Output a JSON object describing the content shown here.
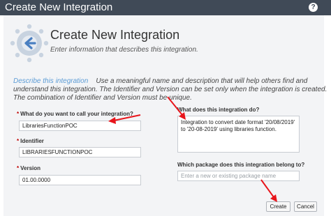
{
  "window": {
    "title": "Create New Integration",
    "help_label": "?"
  },
  "header": {
    "title": "Create New Integration",
    "subtitle": "Enter information that describes this integration."
  },
  "description": {
    "lead": "Describe this integration",
    "text": "Use a meaningful name and description that will help others find and understand this integration. The Identifier and Version can be set only when the integration is created. The combination of Identifier and Version must be unique."
  },
  "form": {
    "name": {
      "label": "What do you want to call your integration?",
      "value": "LibrariesFunctionPOC"
    },
    "identifier": {
      "label": "Identifier",
      "value": "LIBRARIESFUNCTIONPOC"
    },
    "version": {
      "label": "Version",
      "value": "01.00.0000"
    },
    "purpose": {
      "label": "What does this integration do?",
      "value": "Integration to convert date format '20/08/2019' to '20-08-2019' using libraries function."
    },
    "package": {
      "label": "Which package does this integration belong to?",
      "placeholder": "Enter a new or existing package name",
      "value": ""
    }
  },
  "required_marker": "*",
  "buttons": {
    "create": "Create",
    "cancel": "Cancel"
  },
  "colors": {
    "titlebar": "#404a57",
    "accent": "#5b9bd5",
    "annotation_arrow": "#e8151b"
  }
}
